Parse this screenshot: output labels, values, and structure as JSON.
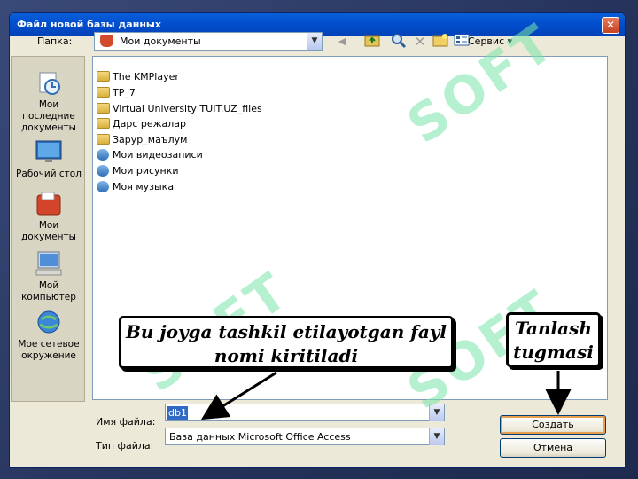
{
  "dialog": {
    "title": "Файл новой базы данных",
    "close_label": "✕"
  },
  "location": {
    "label": "Папка:",
    "value": "Мои документы"
  },
  "toolbar": {
    "service_label": "Сервис ▾"
  },
  "sidebar": {
    "items": [
      {
        "label": "Мои последние документы",
        "icon": "recent-documents-icon"
      },
      {
        "label": "Рабочий стол",
        "icon": "desktop-icon"
      },
      {
        "label": "Мои документы",
        "icon": "my-documents-icon"
      },
      {
        "label": "Мой компьютер",
        "icon": "my-computer-icon"
      },
      {
        "label": "Мое сетевое окружение",
        "icon": "network-icon"
      }
    ]
  },
  "files": [
    {
      "name": "The KMPlayer",
      "icon": "folder-icon"
    },
    {
      "name": "TP_7",
      "icon": "folder-icon"
    },
    {
      "name": "Virtual University TUIT.UZ_files",
      "icon": "folder-icon"
    },
    {
      "name": "Дарс режалар",
      "icon": "folder-icon"
    },
    {
      "name": "Заруp_маълум",
      "icon": "folder-icon"
    },
    {
      "name": "Мои видеозаписи",
      "icon": "media-folder-icon"
    },
    {
      "name": "Мои рисунки",
      "icon": "media-folder-icon"
    },
    {
      "name": "Моя музыка",
      "icon": "media-folder-icon"
    }
  ],
  "filename": {
    "label": "Имя файла:",
    "value": "db1"
  },
  "filetype": {
    "label": "Тип файла:",
    "value": "База данных Microsoft Office Access"
  },
  "buttons": {
    "create": "Создать",
    "cancel": "Отмена"
  },
  "annotations": {
    "filename_note_line1": "Bu joyga tashkil etilayotgan fayl",
    "filename_note_line2": "nomi kiritiladi",
    "button_note_line1": "Tanlash",
    "button_note_line2": "tugmasi"
  },
  "watermark": {
    "text": "SOFT"
  }
}
